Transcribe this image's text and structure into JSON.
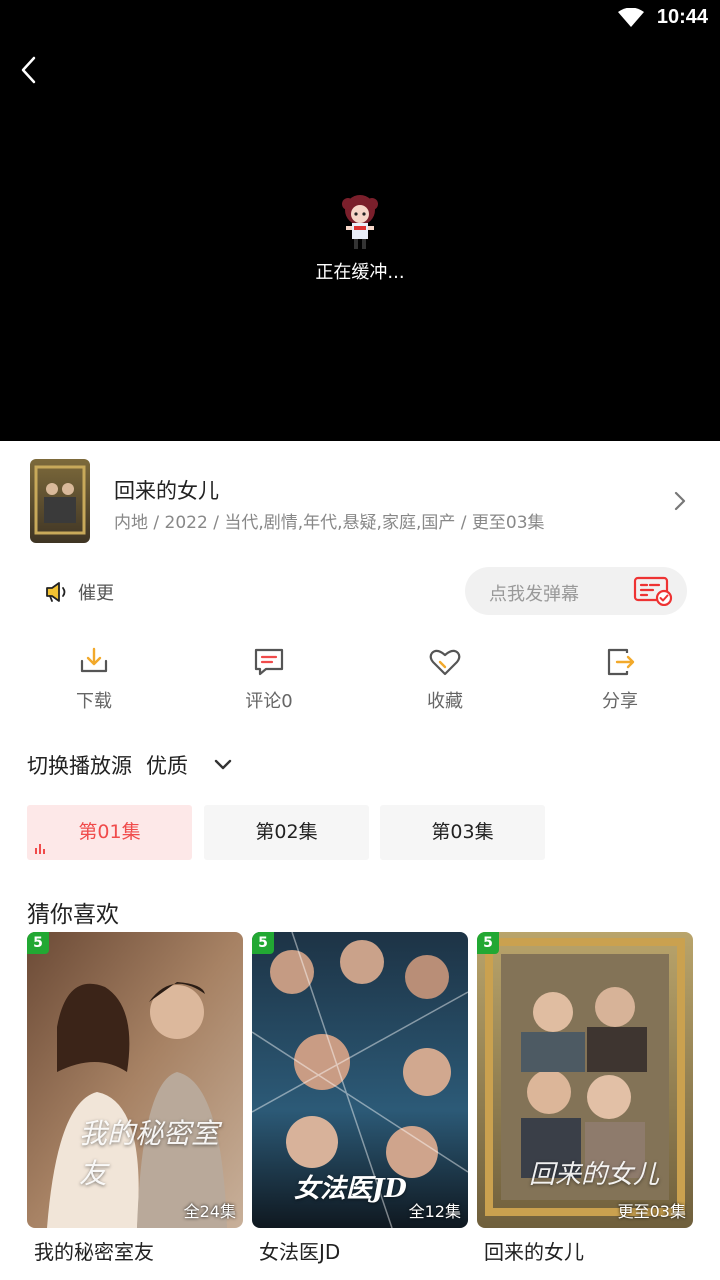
{
  "status": {
    "time": "10:44"
  },
  "player": {
    "buffering_text": "正在缓冲..."
  },
  "show": {
    "title": "回来的女儿",
    "meta": "内地 / 2022 / 当代,剧情,年代,悬疑,家庭,国产 / 更至03集"
  },
  "urge": {
    "label": "催更"
  },
  "danmaku": {
    "placeholder": "点我发弹幕"
  },
  "actions": [
    {
      "label": "下载",
      "icon": "download-icon"
    },
    {
      "label": "评论0",
      "icon": "comment-icon"
    },
    {
      "label": "收藏",
      "icon": "heart-icon"
    },
    {
      "label": "分享",
      "icon": "share-icon"
    }
  ],
  "source": {
    "label": "切换播放源",
    "value": "优质"
  },
  "episodes": [
    {
      "label": "第01集",
      "active": true
    },
    {
      "label": "第02集",
      "active": false
    },
    {
      "label": "第03集",
      "active": false
    }
  ],
  "recommend": {
    "title": "猜你喜欢",
    "items": [
      {
        "name": "我的秘密室友",
        "badge": "5",
        "count": "全24集",
        "art_text": "我的秘密室友"
      },
      {
        "name": "女法医JD",
        "badge": "5",
        "count": "全12集",
        "art_text": "女法医JD"
      },
      {
        "name": "回来的女儿",
        "badge": "5",
        "count": "更至03集",
        "art_text": "回来的女儿"
      }
    ]
  },
  "colors": {
    "accent_red": "#f04b4b",
    "badge_green": "#22a833"
  }
}
